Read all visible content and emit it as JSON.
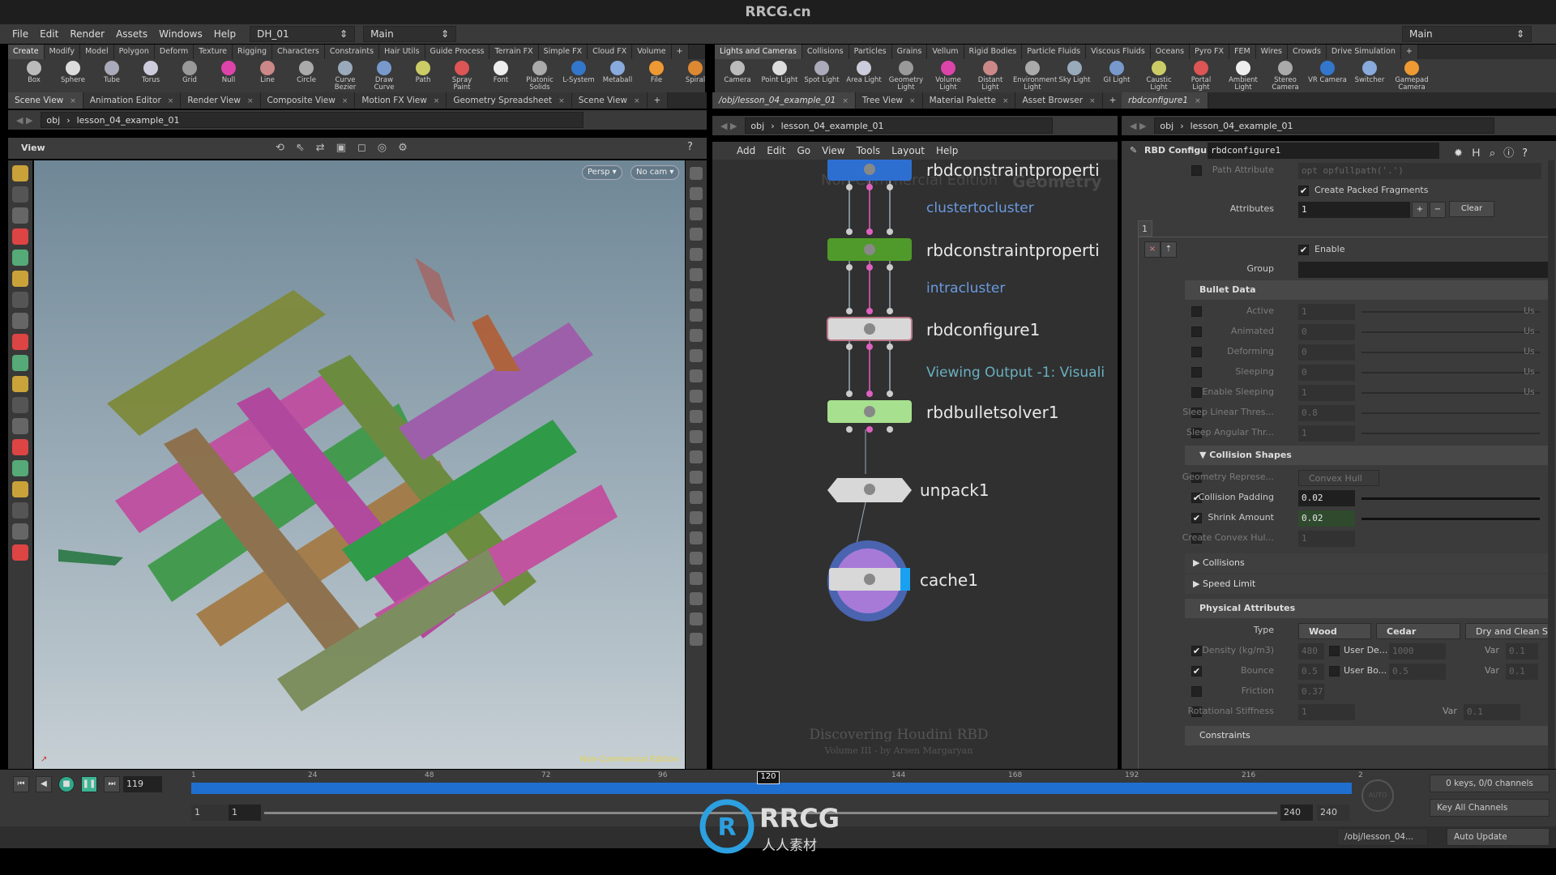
{
  "watermark_title": "RRCG.cn",
  "menubar": {
    "items": [
      "File",
      "Edit",
      "Render",
      "Assets",
      "Windows",
      "Help"
    ],
    "desktop": "DH_01",
    "context": "Main",
    "right_desktop": "Main"
  },
  "shelf_left": {
    "tabs": [
      "Create",
      "Modify",
      "Model",
      "Polygon",
      "Deform",
      "Texture",
      "Rigging",
      "Characters",
      "Constraints",
      "Hair Utils",
      "Guide Process",
      "Terrain FX",
      "Simple FX",
      "Cloud FX",
      "Volume"
    ],
    "tools": [
      "Box",
      "Sphere",
      "Tube",
      "Torus",
      "Grid",
      "Null",
      "Line",
      "Circle",
      "Curve Bezier",
      "Draw Curve",
      "Path",
      "Spray Paint",
      "Font",
      "Platonic Solids",
      "L-System",
      "Metaball",
      "File",
      "Spiral"
    ]
  },
  "shelf_right": {
    "tabs": [
      "Lights and Cameras",
      "Collisions",
      "Particles",
      "Grains",
      "Vellum",
      "Rigid Bodies",
      "Particle Fluids",
      "Viscous Fluids",
      "Oceans",
      "Pyro FX",
      "FEM",
      "Wires",
      "Crowds",
      "Drive Simulation"
    ],
    "tools": [
      "Camera",
      "Point Light",
      "Spot Light",
      "Area Light",
      "Geometry Light",
      "Volume Light",
      "Distant Light",
      "Environment Light",
      "Sky Light",
      "GI Light",
      "Caustic Light",
      "Portal Light",
      "Ambient Light",
      "Stereo Camera",
      "VR Camera",
      "Switcher",
      "Gamepad Camera"
    ]
  },
  "left_pane": {
    "tabs": [
      "Scene View",
      "Animation Editor",
      "Render View",
      "Composite View",
      "Motion FX View",
      "Geometry Spreadsheet",
      "Scene View"
    ],
    "path_root": "obj",
    "path_node": "lesson_04_example_01",
    "view_label": "View",
    "persp": "Persp ▾",
    "cam": "No cam ▾",
    "edition": "Non-Commercial Edition"
  },
  "node_pane": {
    "tabs": [
      "/obj/lesson_04_example_01",
      "Tree View",
      "Material Palette",
      "Asset Browser"
    ],
    "path_root": "obj",
    "path_node": "lesson_04_example_01",
    "menu": [
      "Add",
      "Edit",
      "Go",
      "View",
      "Tools",
      "Layout",
      "Help"
    ],
    "watermark": "Non-Commercial Edition",
    "context_label": "Geometry",
    "nodes": [
      {
        "name": "rbdconstraintproperti",
        "comment": "clustertocluster",
        "color": "#2d6fd1"
      },
      {
        "name": "rbdconstraintproperti",
        "comment": "intracluster",
        "color": "#4f9a2a"
      },
      {
        "name": "rbdconfigure1",
        "comment": "Viewing Output -1: Visuali",
        "color": "#d8d8d8"
      },
      {
        "name": "rbdbulletsolver1",
        "comment": "",
        "color": "#a7e08e"
      },
      {
        "name": "unpack1",
        "comment": "",
        "color": "#d8d8d8"
      },
      {
        "name": "cache1",
        "comment": "",
        "color": "#d8d8d8"
      }
    ],
    "credit_title": "Discovering Houdini RBD",
    "credit_sub": "Volume III - by Arsen Margaryan"
  },
  "param_pane": {
    "tab": "rbdconfigure1",
    "path_root": "obj",
    "path_node": "lesson_04_example_01",
    "node_type": "RBD Configure",
    "node_name": "rbdconfigure1",
    "path_attribute_label": "Path Attribute",
    "path_attribute_value": "opt opfullpath('.')",
    "create_packed_label": "Create Packed Fragments",
    "create_packed": true,
    "attributes_label": "Attributes",
    "attributes_value": "1",
    "plus": "+",
    "minus": "−",
    "clear": "Clear",
    "multiparm_tab": "1",
    "enable_label": "Enable",
    "group_label": "Group",
    "bullet_header": "Bullet Data",
    "bullet_rows": [
      {
        "label": "Active",
        "value": "1",
        "tail": "Us"
      },
      {
        "label": "Animated",
        "value": "0",
        "tail": "Us"
      },
      {
        "label": "Deforming",
        "value": "0",
        "tail": "Us"
      },
      {
        "label": "Sleeping",
        "value": "0",
        "tail": "Us"
      },
      {
        "label": "Enable Sleeping",
        "value": "1",
        "tail": "Us"
      },
      {
        "label": "Sleep Linear Thres...",
        "value": "0.8",
        "tail": ""
      },
      {
        "label": "Sleep Angular Thr...",
        "value": "1",
        "tail": ""
      }
    ],
    "collision_header": "Collision Shapes",
    "geo_rep_label": "Geometry Represe...",
    "geo_rep_value": "Convex Hull",
    "collision_padding_label": "Collision Padding",
    "collision_padding": "0.02",
    "shrink_label": "Shrink Amount",
    "shrink": "0.02",
    "convex_label": "Create Convex Hul...",
    "convex_value": "1",
    "collisions_folder": "Collisions",
    "speed_folder": "Speed Limit",
    "physical_header": "Physical Attributes",
    "type_label": "Type",
    "type_value": "Wood",
    "type2_value": "Cedar",
    "type3_value": "Dry and Clean Su",
    "density_label": "Density (kg/m3)",
    "density": "480",
    "user_density_label": "User De...",
    "user_density": "1000",
    "bounce_label": "Bounce",
    "bounce": "0.5",
    "user_bounce_label": "User Bo...",
    "user_bounce": "0.5",
    "var_label": "Var",
    "var_value": "0.1",
    "friction_label": "Friction",
    "friction": "0.37",
    "rot_label": "Rotational Stiffness",
    "rot": "1",
    "constraints_header": "Constraints"
  },
  "timeline": {
    "current_frame": "119",
    "marker": "120",
    "ticks": [
      "1",
      "24",
      "48",
      "72",
      "96",
      "120",
      "144",
      "168",
      "192",
      "216",
      "2"
    ],
    "start": "1",
    "start2": "1",
    "end": "240",
    "end2": "240",
    "keys": "0 keys, 0/0 channels",
    "key_all": "Key All Channels",
    "auto": "AUTO"
  },
  "status": {
    "path": "/obj/lesson_04...",
    "update": "Auto Update"
  },
  "logo": {
    "text": "RRCG",
    "sub": "人人素材"
  }
}
